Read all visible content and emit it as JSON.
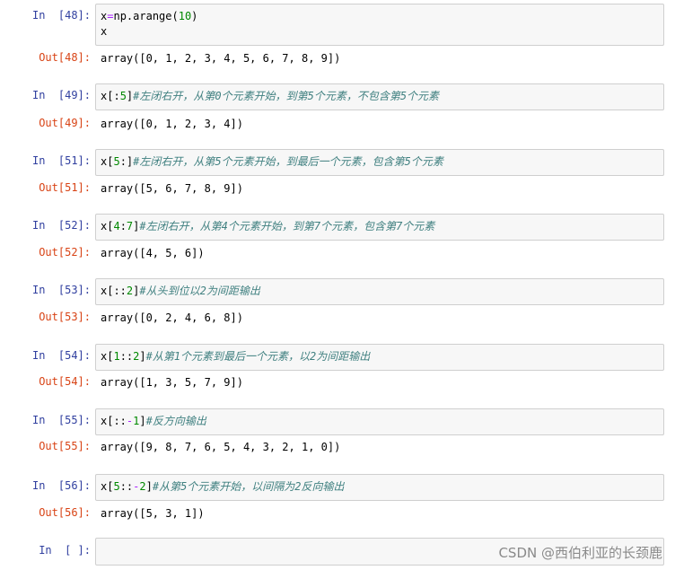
{
  "cells": [
    {
      "in_prompt": "In  [48]:",
      "code_lines": [
        [
          {
            "t": "x",
            "c": ""
          },
          {
            "t": "=",
            "c": "kw"
          },
          {
            "t": "np.arange(",
            "c": ""
          },
          {
            "t": "10",
            "c": "num"
          },
          {
            "t": ")",
            "c": ""
          }
        ],
        [
          {
            "t": "x",
            "c": ""
          }
        ]
      ],
      "out_prompt": "Out[48]:",
      "output": "array([0, 1, 2, 3, 4, 5, 6, 7, 8, 9])"
    },
    {
      "in_prompt": "In  [49]:",
      "code_lines": [
        [
          {
            "t": "x[:",
            "c": ""
          },
          {
            "t": "5",
            "c": "num"
          },
          {
            "t": "]",
            "c": ""
          },
          {
            "t": "#左闭右开，从第0个元素开始，到第5个元素，不包含第5个元素",
            "c": "comment"
          }
        ]
      ],
      "out_prompt": "Out[49]:",
      "output": "array([0, 1, 2, 3, 4])"
    },
    {
      "in_prompt": "In  [51]:",
      "code_lines": [
        [
          {
            "t": "x[",
            "c": ""
          },
          {
            "t": "5",
            "c": "num"
          },
          {
            "t": ":]",
            "c": ""
          },
          {
            "t": "#左闭右开，从第5个元素开始，到最后一个元素，包含第5个元素",
            "c": "comment"
          }
        ]
      ],
      "out_prompt": "Out[51]:",
      "output": "array([5, 6, 7, 8, 9])"
    },
    {
      "in_prompt": "In  [52]:",
      "code_lines": [
        [
          {
            "t": "x[",
            "c": ""
          },
          {
            "t": "4",
            "c": "num"
          },
          {
            "t": ":",
            "c": ""
          },
          {
            "t": "7",
            "c": "num"
          },
          {
            "t": "]",
            "c": ""
          },
          {
            "t": "#左闭右开，从第4个元素开始，到第7个元素，包含第7个元素",
            "c": "comment"
          }
        ]
      ],
      "out_prompt": "Out[52]:",
      "output": "array([4, 5, 6])"
    },
    {
      "in_prompt": "In  [53]:",
      "code_lines": [
        [
          {
            "t": "x[::",
            "c": ""
          },
          {
            "t": "2",
            "c": "num"
          },
          {
            "t": "]",
            "c": ""
          },
          {
            "t": "#从头到位以2为间距输出",
            "c": "comment"
          }
        ]
      ],
      "out_prompt": "Out[53]:",
      "output": "array([0, 2, 4, 6, 8])"
    },
    {
      "in_prompt": "In  [54]:",
      "code_lines": [
        [
          {
            "t": "x[",
            "c": ""
          },
          {
            "t": "1",
            "c": "num"
          },
          {
            "t": "::",
            "c": ""
          },
          {
            "t": "2",
            "c": "num"
          },
          {
            "t": "]",
            "c": ""
          },
          {
            "t": "#从第1个元素到最后一个元素，以2为间距输出",
            "c": "comment"
          }
        ]
      ],
      "out_prompt": "Out[54]:",
      "output": "array([1, 3, 5, 7, 9])"
    },
    {
      "in_prompt": "In  [55]:",
      "code_lines": [
        [
          {
            "t": "x[::",
            "c": ""
          },
          {
            "t": "-",
            "c": "kw"
          },
          {
            "t": "1",
            "c": "num"
          },
          {
            "t": "]",
            "c": ""
          },
          {
            "t": "#反方向输出",
            "c": "comment"
          }
        ]
      ],
      "out_prompt": "Out[55]:",
      "output": "array([9, 8, 7, 6, 5, 4, 3, 2, 1, 0])"
    },
    {
      "in_prompt": "In  [56]:",
      "code_lines": [
        [
          {
            "t": "x[",
            "c": ""
          },
          {
            "t": "5",
            "c": "num"
          },
          {
            "t": "::",
            "c": ""
          },
          {
            "t": "-",
            "c": "kw"
          },
          {
            "t": "2",
            "c": "num"
          },
          {
            "t": "]",
            "c": ""
          },
          {
            "t": "#从第5个元素开始，以间隔为2反向输出",
            "c": "comment"
          }
        ]
      ],
      "out_prompt": "Out[56]:",
      "output": "array([5, 3, 1])"
    },
    {
      "in_prompt": "In  [ ]:",
      "code_lines": [],
      "out_prompt": "",
      "output": ""
    }
  ],
  "watermark": "CSDN @西伯利亚的长颈鹿",
  "colors": {
    "in_prompt": "#303f9f",
    "out_prompt": "#d84315",
    "comment": "#408080",
    "number": "#008800",
    "operator": "#aa22ff",
    "input_bg": "#f7f7f7"
  }
}
